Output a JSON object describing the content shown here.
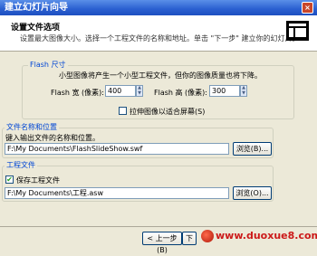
{
  "window": {
    "title": "建立幻灯片向导",
    "close_glyph": "×",
    "min_glyph": "_"
  },
  "header": {
    "title": "设置文件选项",
    "description": "设置最大图像大小。选择一个工程文件的名称和地址。单击 \"下一步\" 建立你的幻灯片。",
    "icon": "slideshow-layout-icon"
  },
  "flash_group": {
    "label": "Flash 尺寸",
    "hint": "小型图像将产生一个小型工程文件，但你的图像质量也将下降。",
    "width_label": "Flash 宽 (像素):",
    "width_value": "400",
    "height_label": "Flash 高 (像素):",
    "height_value": "300",
    "stretch_label": "拉伸图像以适合屏幕(S)",
    "stretch_checked": false
  },
  "output_group": {
    "label": "文件名称和位置",
    "prompt": "键入输出文件的名称和位置。",
    "path": "F:\\My Documents\\FlashSlideShow.swf",
    "browse_label": "浏览(B)..."
  },
  "project_group": {
    "label": "工程文件",
    "save_label": "保存工程文件",
    "save_checked": true,
    "path": "F:\\My Documents\\工程.asw",
    "browse_label": "浏览(O)..."
  },
  "footer": {
    "back_label": "< 上一步(B)",
    "next_label": "下"
  },
  "watermark": {
    "text": "www.duoxue8.com"
  }
}
